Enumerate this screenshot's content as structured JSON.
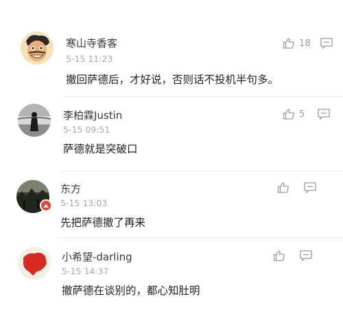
{
  "comments": [
    {
      "user": "寒山寺香客",
      "time": "5-15 11:23",
      "text": "撤回萨德后，才好说，否则话不投机半句多。",
      "likes": "18",
      "avatar": "cartoon-face-avatar"
    },
    {
      "user": "李柏霖Justin",
      "time": "5-15 09:51",
      "text": "萨德就是突破口",
      "likes": "5",
      "avatar": "silhouette-photo-avatar"
    },
    {
      "user": "东方",
      "time": "5-15 13:03",
      "text": "先把萨德撤了再来",
      "likes": "",
      "avatar": "landscape-photo-avatar"
    },
    {
      "user": "小希望-darling",
      "time": "5-15 14:37",
      "text": "撤萨德在谈别的，都心知肚明",
      "likes": "",
      "avatar": "china-map-avatar"
    }
  ],
  "colors": {
    "text": "#1f1f1f",
    "meta": "#a8a8a8",
    "icon": "#9a9a9a",
    "badge": "#e1442f"
  }
}
